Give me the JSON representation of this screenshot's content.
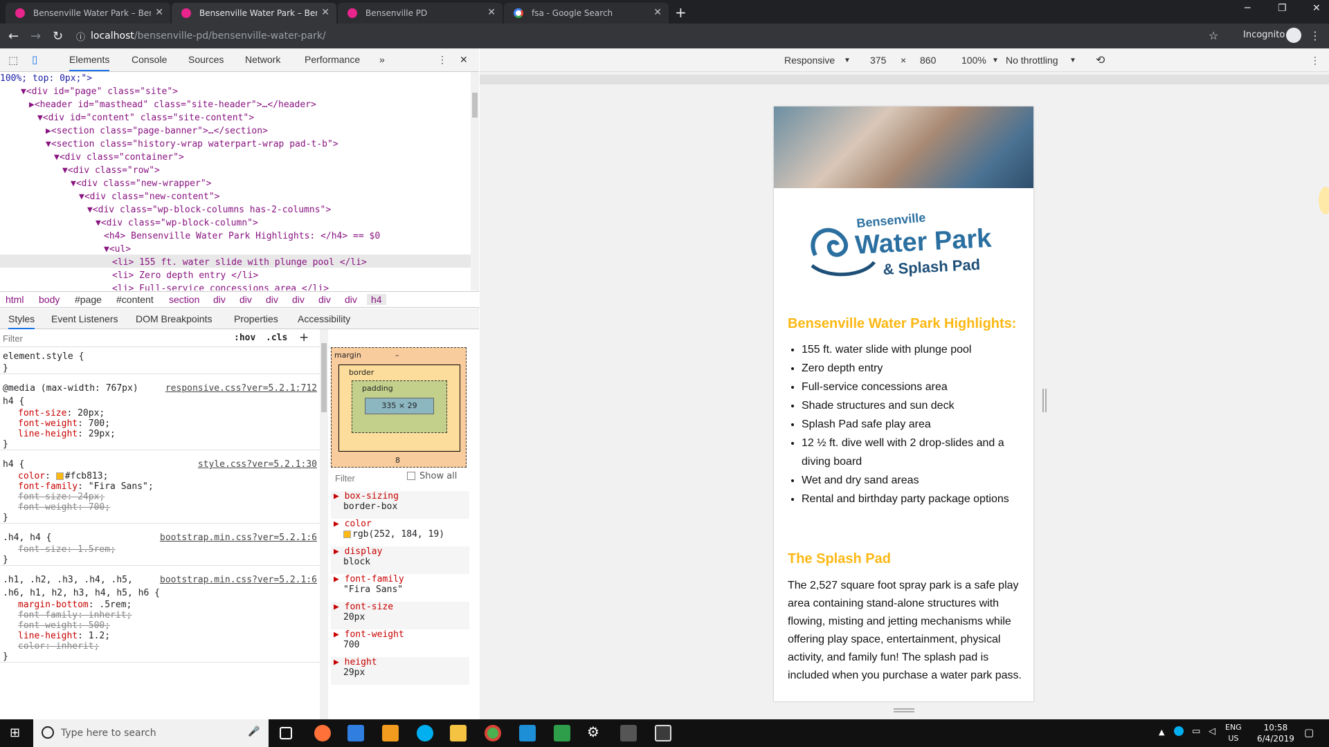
{
  "tabs": [
    {
      "title": "Bensenville Water Park – Bensenville",
      "active": false
    },
    {
      "title": "Bensenville Water Park – Bensenville",
      "active": true
    },
    {
      "title": "Bensenville PD",
      "active": false
    },
    {
      "title": "fsa - Google Search",
      "active": false
    }
  ],
  "address": {
    "host": "localhost",
    "path": "/bensenville-pd/bensenville-water-park/",
    "incognito": "Incognito"
  },
  "devtools": {
    "tabs": [
      "Elements",
      "Console",
      "Sources",
      "Network",
      "Performance"
    ],
    "dom": [
      {
        "indent": 0,
        "text": "100%; top: 0px;\">"
      },
      {
        "indent": 1,
        "text": "▼<div id=\"page\" class=\"site\">"
      },
      {
        "indent": 2,
        "text": "▶<header id=\"masthead\" class=\"site-header\">…</header>"
      },
      {
        "indent": 2,
        "text": "▼<div id=\"content\" class=\"site-content\">"
      },
      {
        "indent": 3,
        "text": "▶<section class=\"page-banner\">…</section>"
      },
      {
        "indent": 3,
        "text": "▼<section class=\"history-wrap waterpart-wrap pad-t-b\">"
      },
      {
        "indent": 4,
        "text": "▼<div class=\"container\">"
      },
      {
        "indent": 5,
        "text": "▼<div class=\"row\">"
      },
      {
        "indent": 6,
        "text": "▼<div class=\"new-wrapper\">"
      },
      {
        "indent": 7,
        "text": "▼<div class=\"new-content\">"
      },
      {
        "indent": 8,
        "text": "▼<div class=\"wp-block-columns has-2-columns\">"
      },
      {
        "indent": 9,
        "text": "▼<div class=\"wp-block-column\">"
      },
      {
        "indent": 10,
        "text": "<h4> Bensenville Water Park Highlights: </h4> == $0"
      },
      {
        "indent": 10,
        "text": "▼<ul>"
      },
      {
        "indent": 11,
        "text": "<li> 155 ft. water slide with plunge pool </li>"
      },
      {
        "indent": 11,
        "text": "<li> Zero depth entry </li>"
      },
      {
        "indent": 11,
        "text": "<li> Full-service concessions area </li>"
      }
    ],
    "breadcrumbs": [
      "html",
      "body",
      "#page",
      "#content",
      "section",
      "div",
      "div",
      "div",
      "div",
      "div",
      "div",
      "h4"
    ],
    "subtabs": [
      "Styles",
      "Event Listeners",
      "DOM Breakpoints",
      "Properties",
      "Accessibility"
    ],
    "filter_placeholder": "Filter",
    "hov": ":hov",
    "cls": ".cls",
    "plus": "+",
    "rules": [
      {
        "selector": "element.style {",
        "source": "",
        "lines": [],
        "close": "}"
      },
      {
        "selector": "@media (max-width: 767px)\nh4 {",
        "source": "responsive.css?ver=5.2.1:712",
        "lines": [
          {
            "p": "font-size",
            "v": "20px;",
            "strike": false
          },
          {
            "p": "font-weight",
            "v": "700;",
            "strike": false
          },
          {
            "p": "line-height",
            "v": "29px;",
            "strike": false
          }
        ],
        "close": "}"
      },
      {
        "selector": "h4 {",
        "source": "style.css?ver=5.2.1:30",
        "lines": [
          {
            "p": "color",
            "v": "#fcb813;",
            "strike": false,
            "swatch": true
          },
          {
            "p": "font-family",
            "v": "\"Fira Sans\";",
            "strike": false
          },
          {
            "p": "font-size",
            "v": "24px;",
            "strike": true
          },
          {
            "p": "font-weight",
            "v": "700;",
            "strike": true
          }
        ],
        "close": "}"
      },
      {
        "selector": ".h4, h4 {",
        "source": "bootstrap.min.css?ver=5.2.1:6",
        "lines": [
          {
            "p": "font-size",
            "v": "1.5rem;",
            "strike": true
          }
        ],
        "close": "}"
      },
      {
        "selector": ".h1, .h2, .h3, .h4, .h5,\n.h6, h1, h2, h3, h4, h5, h6 {",
        "source": "bootstrap.min.css?ver=5.2.1:6",
        "lines": [
          {
            "p": "margin-bottom",
            "v": ".5rem;",
            "strike": false
          },
          {
            "p": "font-family",
            "v": "inherit;",
            "strike": true
          },
          {
            "p": "font-weight",
            "v": "500;",
            "strike": true
          },
          {
            "p": "line-height",
            "v": "1.2;",
            "strike": false
          },
          {
            "p": "color",
            "v": "inherit;",
            "strike": true
          }
        ],
        "close": "}"
      }
    ],
    "boxmodel": {
      "margin": "margin",
      "border": "border",
      "padding": "padding",
      "dash": "–",
      "content": "335 × 29",
      "margin_bottom": "8"
    },
    "computed_filter": "Filter",
    "show_all": "Show all",
    "computed": [
      {
        "p": "box-sizing",
        "v": "border-box"
      },
      {
        "p": "color",
        "v": "rgb(252, 184, 19)",
        "swatch": true
      },
      {
        "p": "display",
        "v": "block"
      },
      {
        "p": "font-family",
        "v": "\"Fira Sans\""
      },
      {
        "p": "font-size",
        "v": "20px"
      },
      {
        "p": "font-weight",
        "v": "700"
      },
      {
        "p": "height",
        "v": "29px"
      }
    ]
  },
  "devbar": {
    "mode": "Responsive",
    "width": "375",
    "x": "×",
    "height": "860",
    "zoom": "100%",
    "throttle": "No throttling"
  },
  "site": {
    "logo_top": "Bensenville",
    "logo_main": "Water Park",
    "logo_sub": "& Splash Pad",
    "heading1": "Bensenville Water Park Highlights:",
    "highlights": [
      "155 ft. water slide with plunge pool",
      "Zero depth entry",
      "Full-service concessions area",
      "Shade structures and sun deck",
      "Splash Pad safe play area",
      "12 ½ ft. dive well with 2 drop-slides and a diving board",
      "Wet and dry sand areas",
      "Rental and birthday party package options"
    ],
    "heading2": "The Splash Pad",
    "paragraph": "The 2,527 square foot spray park is a safe play area containing stand-alone structures with flowing, misting and jetting mechanisms while offering play space, entertainment, physical activity, and family fun! The splash pad is included when you purchase a water park pass."
  },
  "taskbar": {
    "search_placeholder": "Type here to search",
    "lang": "ENG",
    "region": "US",
    "time": "10:58",
    "date": "6/4/2019"
  },
  "colors": {
    "accent": "#fcb813",
    "chrome_dark": "#202124",
    "devtools_blue": "#1a73e8"
  }
}
